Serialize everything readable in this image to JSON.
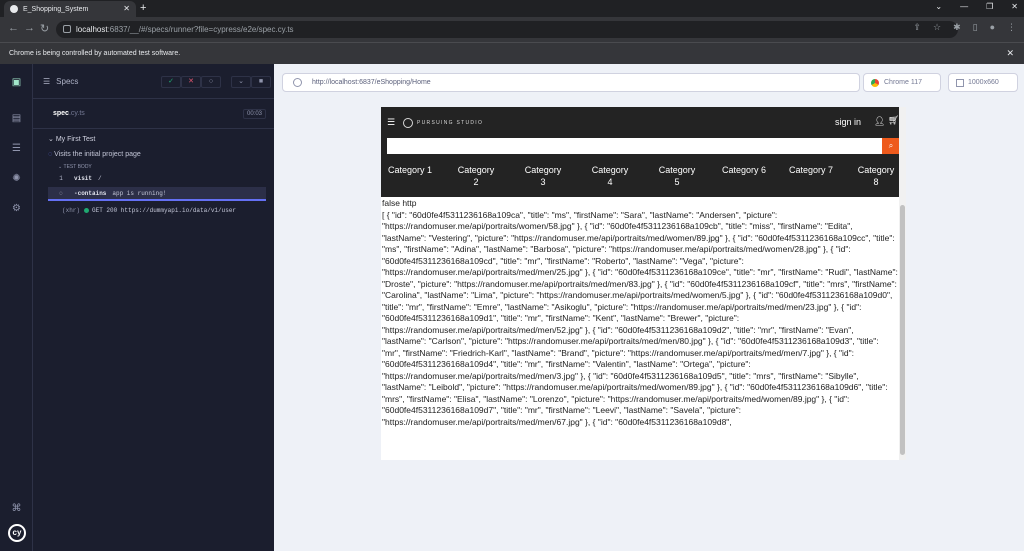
{
  "chrome": {
    "tab_title": "E_Shopping_System",
    "url_host": "localhost",
    "url_path": ":6837/__/#/specs/runner?file=cypress/e2e/spec.cy.ts",
    "infobar": "Chrome is being controlled by automated test software."
  },
  "reporter": {
    "header": "Specs",
    "spec_name": "spec",
    "spec_ext": ".cy.ts",
    "duration": "00:03",
    "suite": "My First Test",
    "test": "Visits the initial project page",
    "test_body_label": "TEST BODY",
    "commands": [
      {
        "num": "1",
        "name": "visit",
        "message": "/"
      },
      {
        "num": "",
        "name": "-contains",
        "message": "app is running!"
      },
      {
        "num": "(xhr)",
        "name": "",
        "message": "GET 200 https://dummyapi.io/data/v1/user"
      }
    ]
  },
  "runner": {
    "url": "http://localhost:6837/eShopping/Home",
    "browser": "Chrome 117",
    "viewport": "1000x660"
  },
  "aut": {
    "brand": "PURSUING STUDIO",
    "signin": "sign in",
    "categories": [
      "Category 1",
      "Category 2",
      "Category 3",
      "Category 4",
      "Category 5",
      "Category 6",
      "Category 7",
      "Category 8"
    ],
    "line1": "false http",
    "json_dump": "[ { \"id\": \"60d0fe4f5311236168a109ca\", \"title\": \"ms\", \"firstName\": \"Sara\", \"lastName\": \"Andersen\", \"picture\": \"https://randomuser.me/api/portraits/women/58.jpg\" }, { \"id\": \"60d0fe4f5311236168a109cb\", \"title\": \"miss\", \"firstName\": \"Edita\", \"lastName\": \"Vestering\", \"picture\": \"https://randomuser.me/api/portraits/med/women/89.jpg\" }, { \"id\": \"60d0fe4f5311236168a109cc\", \"title\": \"ms\", \"firstName\": \"Adina\", \"lastName\": \"Barbosa\", \"picture\": \"https://randomuser.me/api/portraits/med/women/28.jpg\" }, { \"id\": \"60d0fe4f5311236168a109cd\", \"title\": \"mr\", \"firstName\": \"Roberto\", \"lastName\": \"Vega\", \"picture\": \"https://randomuser.me/api/portraits/med/men/25.jpg\" }, { \"id\": \"60d0fe4f5311236168a109ce\", \"title\": \"mr\", \"firstName\": \"Rudi\", \"lastName\": \"Droste\", \"picture\": \"https://randomuser.me/api/portraits/med/men/83.jpg\" }, { \"id\": \"60d0fe4f5311236168a109cf\", \"title\": \"mrs\", \"firstName\": \"Carolina\", \"lastName\": \"Lima\", \"picture\": \"https://randomuser.me/api/portraits/med/women/5.jpg\" }, { \"id\": \"60d0fe4f5311236168a109d0\", \"title\": \"mr\", \"firstName\": \"Emre\", \"lastName\": \"Asikoglu\", \"picture\": \"https://randomuser.me/api/portraits/med/men/23.jpg\" }, { \"id\": \"60d0fe4f5311236168a109d1\", \"title\": \"mr\", \"firstName\": \"Kent\", \"lastName\": \"Brewer\", \"picture\": \"https://randomuser.me/api/portraits/med/men/52.jpg\" }, { \"id\": \"60d0fe4f5311236168a109d2\", \"title\": \"mr\", \"firstName\": \"Evan\", \"lastName\": \"Carlson\", \"picture\": \"https://randomuser.me/api/portraits/med/men/80.jpg\" }, { \"id\": \"60d0fe4f5311236168a109d3\", \"title\": \"mr\", \"firstName\": \"Friedrich-Karl\", \"lastName\": \"Brand\", \"picture\": \"https://randomuser.me/api/portraits/med/men/7.jpg\" }, { \"id\": \"60d0fe4f5311236168a109d4\", \"title\": \"mr\", \"firstName\": \"Valentin\", \"lastName\": \"Ortega\", \"picture\": \"https://randomuser.me/api/portraits/med/men/3.jpg\" }, { \"id\": \"60d0fe4f5311236168a109d5\", \"title\": \"mrs\", \"firstName\": \"Sibylle\", \"lastName\": \"Leibold\", \"picture\": \"https://randomuser.me/api/portraits/med/women/89.jpg\" }, { \"id\": \"60d0fe4f5311236168a109d6\", \"title\": \"mrs\", \"firstName\": \"Elisa\", \"lastName\": \"Lorenzo\", \"picture\": \"https://randomuser.me/api/portraits/med/women/89.jpg\" }, { \"id\": \"60d0fe4f5311236168a109d7\", \"title\": \"mr\", \"firstName\": \"Leevi\", \"lastName\": \"Savela\", \"picture\": \"https://randomuser.me/api/portraits/med/men/67.jpg\" }, { \"id\": \"60d0fe4f5311236168a109d8\","
  },
  "colors": {
    "cypress_bg": "#1b1e2e",
    "runner_bg": "#eef1f7",
    "aut_nav": "#232323",
    "search_btn": "#ee5a1c",
    "pass_green": "#1fa971",
    "accent_indigo": "#6470f3"
  }
}
